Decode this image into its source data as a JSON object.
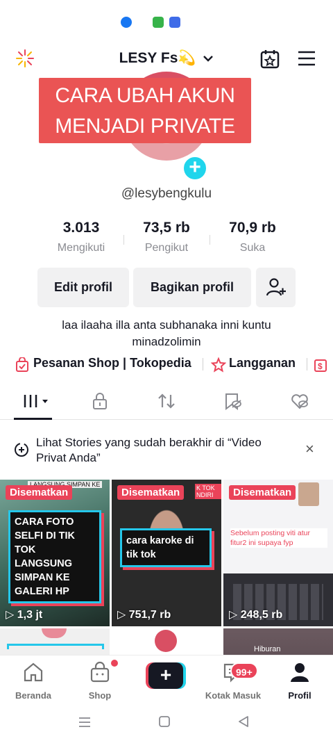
{
  "status": {
    "icons": [
      "facebook-icon",
      "phone-clone-icon",
      "nfc-icon"
    ]
  },
  "header": {
    "username": "LESY Fs💫",
    "dropdown_icon": "chevron-down-icon"
  },
  "banner": {
    "text": "CARA UBAH AKUN MENJADI PRIVATE"
  },
  "profile": {
    "handle": "@lesybengkulu"
  },
  "stats": [
    {
      "value": "3.013",
      "label": "Mengikuti"
    },
    {
      "value": "73,5 rb",
      "label": "Pengikut"
    },
    {
      "value": "70,9 rb",
      "label": "Suka"
    }
  ],
  "buttons": {
    "edit": "Edit profil",
    "share": "Bagikan profil"
  },
  "bio": "laa ilaaha illa anta subhanaka inni kuntu minadzolimin",
  "links": {
    "shop": "Pesanan Shop | Tokopedia",
    "sub": "Langganan"
  },
  "notice": {
    "text": "Lihat Stories yang sudah berakhir di “Video Privat Anda”",
    "close": "×"
  },
  "videos": [
    {
      "pin": "Disematkan",
      "views": "1,3 jt",
      "caption": "CARA FOTO SELFI DI TIK TOK LANGSUNG SIMPAN KE GALERI HP",
      "top": "LANGSUNG SIMPAN KE"
    },
    {
      "pin": "Disematkan",
      "views": "751,7 rb",
      "caption": "cara karoke di tik tok",
      "top": "K TOK NDIRI"
    },
    {
      "pin": "Disematkan",
      "views": "248,5 rb",
      "caption": "Sebelum posting viti atur fitur2 ini supaya fyp"
    }
  ],
  "second_row": {
    "text": "Hiburan"
  },
  "nav": {
    "home": "Beranda",
    "shop": "Shop",
    "create": "+",
    "inbox": "Kotak Masuk",
    "inbox_badge": "99+",
    "profile": "Profil"
  },
  "colors": {
    "accent": "#ea4359",
    "cyan": "#20d5ec",
    "banner": "#ea5454"
  }
}
